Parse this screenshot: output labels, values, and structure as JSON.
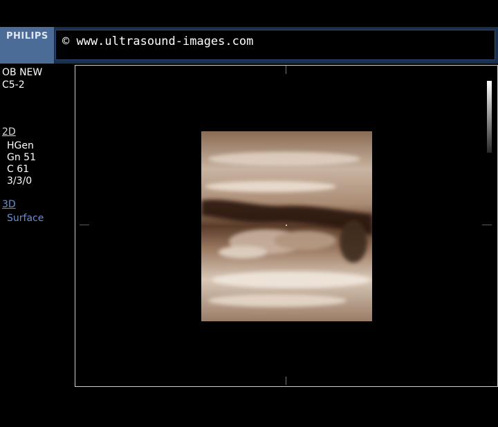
{
  "header": {
    "brand": "PHILIPS",
    "url": "© www.ultrasound-images.com"
  },
  "left_panel": {
    "preset": "OB NEW",
    "probe": "C5-2",
    "mode_2d": {
      "label": "2D",
      "params": [
        "HGen",
        "Gn 51",
        "C 61",
        "3/3/0"
      ]
    },
    "mode_3d": {
      "label": "3D",
      "render_mode": "Surface"
    }
  },
  "colors": {
    "header_bg": "#1a2f4e",
    "brand_bg": "#4a6c96",
    "accent_3d": "#6a8fcf",
    "tissue_tint": "#b08c6e",
    "marker_red": "#c0302a",
    "marker_blue": "#4a7cc4"
  }
}
